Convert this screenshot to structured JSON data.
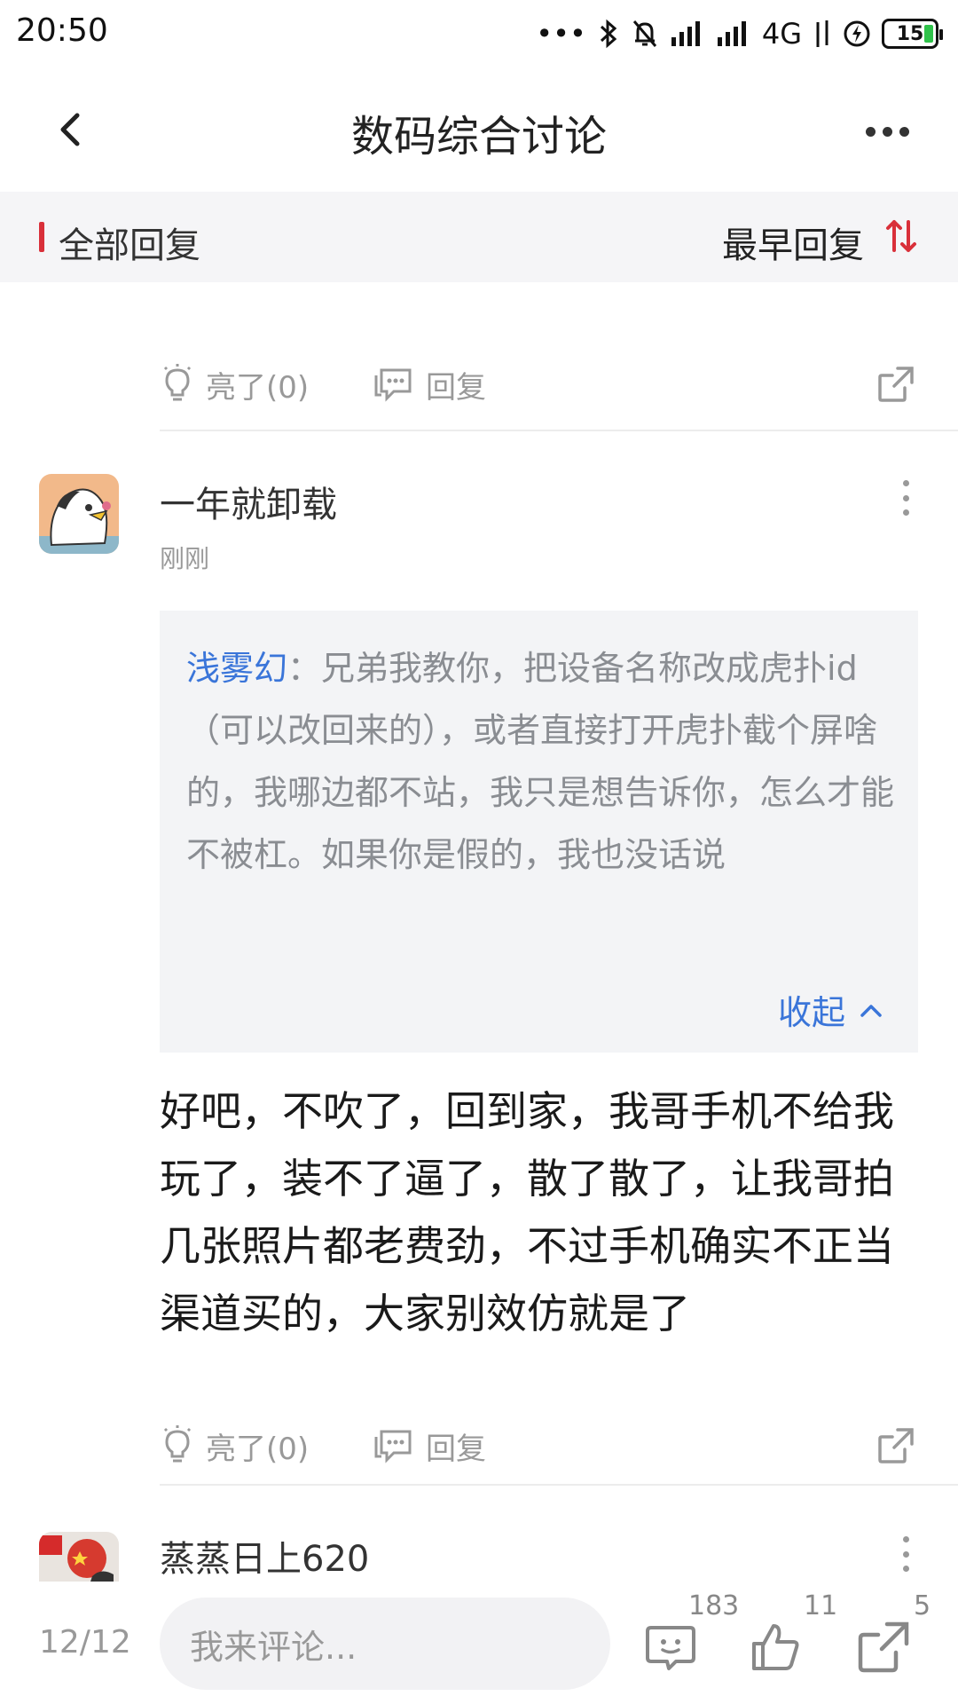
{
  "status": {
    "time": "20:50",
    "network": "4G",
    "battery": "15"
  },
  "header": {
    "title": "数码综合讨论"
  },
  "sort": {
    "all_replies": "全部回复",
    "order": "最早回复"
  },
  "actions": {
    "like": "亮了(0)",
    "reply": "回复"
  },
  "comment": {
    "username": "一年就卸载",
    "time": "刚刚",
    "quote_user": "浅雾幻",
    "quote_sep": "：",
    "quote_text": "兄弟我教你，把设备名称改成虎扑id（可以改回来的），或者直接打开虎扑截个屏啥的，我哪边都不站，我只是想告诉你，怎么才能不被杠。如果你是假的，我也没话说",
    "collapse": "收起",
    "text": "好吧，不吹了，回到家，我哥手机不给我玩了，装不了逼了，散了散了，让我哥拍几张照片都老费劲，不过手机确实不正当渠道买的，大家别效仿就是了"
  },
  "next_comment": {
    "username": "蒸蒸日上620"
  },
  "bottom": {
    "page_counter": "12/12",
    "input_placeholder": "我来评论...",
    "comments_count": "183",
    "likes_count": "11",
    "shares_count": "5"
  },
  "colors": {
    "accent_red": "#d9303a",
    "link_blue": "#3a75d9",
    "battery_green": "#2fc24a"
  }
}
